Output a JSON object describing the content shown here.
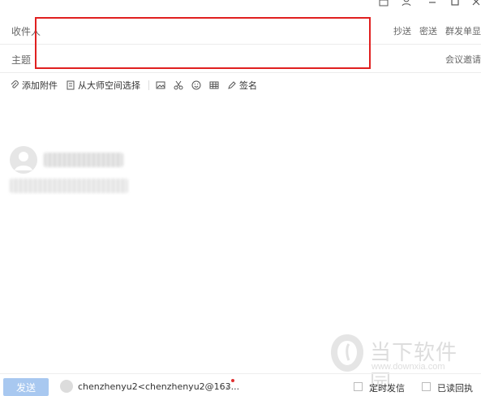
{
  "header": {
    "to_label": "收件人",
    "subject_label": "主题",
    "cc_label": "抄送",
    "bcc_label": "密送",
    "group_single_label": "群发单显",
    "meeting_label": "会议邀请"
  },
  "toolbar": {
    "attach_label": "添加附件",
    "master_space_label": "从大师空间选择",
    "signature_label": "签名"
  },
  "footer": {
    "send_label": "发送",
    "account": "chenzhenyu2<chenzhenyu2@163...",
    "scheduled_label": "定时发信",
    "read_receipt_label": "已读回执"
  },
  "watermark": {
    "name": "当下软件园",
    "url": "www.downxia.com"
  },
  "colors": {
    "highlight": "#e02020",
    "send_button": "#a8c8f0",
    "badge_dot": "#e03030"
  }
}
